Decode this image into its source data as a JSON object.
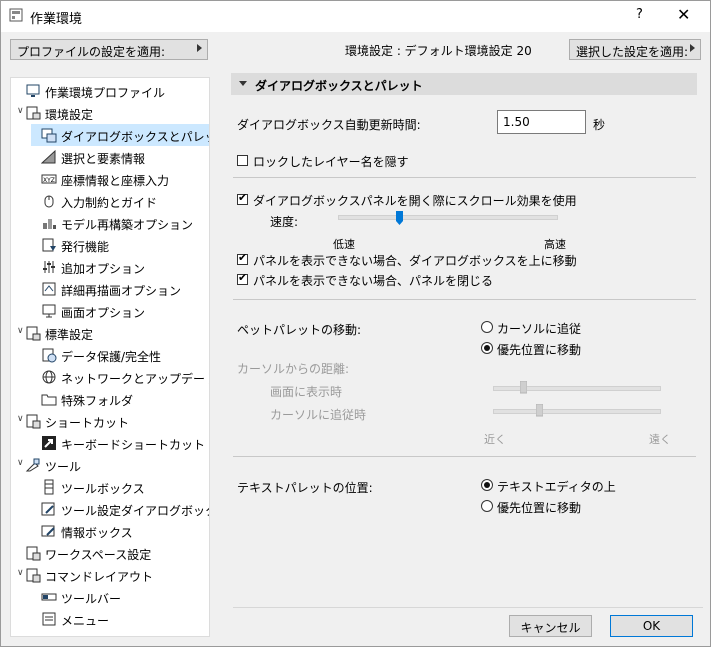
{
  "window": {
    "title": "作業環境",
    "help": "?",
    "close": "✕"
  },
  "toolbar": {
    "apply_profile": "プロファイルの設定を適用:",
    "env_label": "環境設定 : デフォルト環境設定 20",
    "apply_selected": "選択した設定を適用:"
  },
  "tree": [
    {
      "label": "作業環境プロファイル",
      "level": 0,
      "expanded": null,
      "icon": "monitor-profile-icon"
    },
    {
      "label": "環境設定",
      "level": 0,
      "expanded": true,
      "icon": "environment-settings-icon"
    },
    {
      "label": "ダイアログボックスとパレット",
      "level": 1,
      "selected": true,
      "icon": "dialog-palette-icon"
    },
    {
      "label": "選択と要素情報",
      "level": 1,
      "icon": "selection-info-icon"
    },
    {
      "label": "座標情報と座標入力",
      "level": 1,
      "icon": "xyz-coordinates-icon"
    },
    {
      "label": "入力制約とガイド",
      "level": 1,
      "icon": "mouse-guide-icon"
    },
    {
      "label": "モデル再構築オプション",
      "level": 1,
      "icon": "model-rebuild-icon"
    },
    {
      "label": "発行機能",
      "level": 1,
      "icon": "publish-icon"
    },
    {
      "label": "追加オプション",
      "level": 1,
      "icon": "sliders-icon"
    },
    {
      "label": "詳細再描画オプション",
      "level": 1,
      "icon": "redraw-options-icon"
    },
    {
      "label": "画面オプション",
      "level": 1,
      "icon": "display-options-icon"
    },
    {
      "label": "標準設定",
      "level": 0,
      "expanded": true,
      "icon": "standard-settings-icon"
    },
    {
      "label": "データ保護/完全性",
      "level": 1,
      "icon": "data-protection-icon"
    },
    {
      "label": "ネットワークとアップデート",
      "level": 1,
      "icon": "globe-icon"
    },
    {
      "label": "特殊フォルダ",
      "level": 1,
      "icon": "folder-icon"
    },
    {
      "label": "ショートカット",
      "level": 0,
      "expanded": true,
      "icon": "shortcuts-icon"
    },
    {
      "label": "キーボードショートカット",
      "level": 1,
      "icon": "keyboard-shortcut-icon"
    },
    {
      "label": "ツール",
      "level": 0,
      "expanded": true,
      "icon": "tools-icon"
    },
    {
      "label": "ツールボックス",
      "level": 1,
      "icon": "toolbox-icon"
    },
    {
      "label": "ツール設定ダイアログボックス",
      "level": 1,
      "icon": "tool-settings-dialog-icon"
    },
    {
      "label": "情報ボックス",
      "level": 1,
      "icon": "info-box-icon"
    },
    {
      "label": "ワークスペース設定",
      "level": 0,
      "expanded": null,
      "icon": "workspace-settings-icon"
    },
    {
      "label": "コマンドレイアウト",
      "level": 0,
      "expanded": true,
      "icon": "command-layout-icon"
    },
    {
      "label": "ツールバー",
      "level": 1,
      "icon": "toolbar-icon"
    },
    {
      "label": "メニュー",
      "level": 1,
      "icon": "menu-icon"
    }
  ],
  "panel": {
    "header": "ダイアログボックスとパレット",
    "auto_refresh_label": "ダイアログボックス自動更新時間:",
    "auto_refresh_value": "1.50",
    "auto_refresh_unit": "秒",
    "hide_locked_layer": {
      "label": "ロックしたレイヤー名を隠す",
      "checked": false
    },
    "scroll_effect": {
      "label": "ダイアログボックスパネルを開く際にスクロール効果を使用",
      "checked": true
    },
    "speed_label": "速度:",
    "speed_low": "低速",
    "speed_high": "高速",
    "speed_value": 0.27,
    "move_dialog_up": {
      "label": "パネルを表示できない場合、ダイアログボックスを上に移動",
      "checked": true
    },
    "close_panel": {
      "label": "パネルを表示できない場合、パネルを閉じる",
      "checked": true
    },
    "pet_palette_label": "ペットパレットの移動:",
    "pet_opt1": "カーソルに追従",
    "pet_opt2": "優先位置に移動",
    "pet_selected": 2,
    "cursor_distance_label": "カーソルからの距離:",
    "screen_display_label": "画面に表示時",
    "cursor_follow_label": "カーソルに追従時",
    "screen_display_value": 0.17,
    "cursor_follow_value": 0.27,
    "near": "近く",
    "far": "遠く",
    "text_palette_label": "テキストパレットの位置:",
    "text_opt1": "テキストエディタの上",
    "text_opt2": "優先位置に移動",
    "text_selected": 1
  },
  "footer": {
    "cancel": "キャンセル",
    "ok": "OK"
  },
  "colors": {
    "accent": "#0078d7",
    "selection": "#cce8ff",
    "header_bg": "#dcdcdc"
  }
}
